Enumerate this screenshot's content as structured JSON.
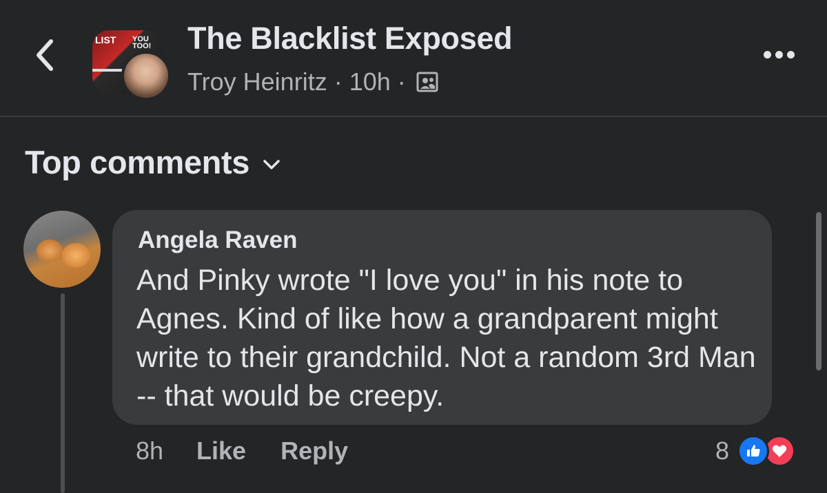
{
  "header": {
    "back_icon": "chevron-left-icon",
    "group_name": "The Blacklist Exposed",
    "group_avatar_text_1": "LIST",
    "group_avatar_text_2": "YOU TOO!",
    "author": "Troy Heinritz",
    "separator": "·",
    "time": "10h",
    "privacy_icon": "group-members-icon",
    "more_icon": "more-horizontal-icon"
  },
  "sort": {
    "label": "Top comments",
    "icon": "chevron-down-icon"
  },
  "comment": {
    "author": "Angela Raven",
    "text": "And Pinky wrote \"I love you\" in his note to Agnes. Kind of like how a grandparent might write to their grandchild. Not a random 3rd Man -- that would be creepy.",
    "time": "8h",
    "like_label": "Like",
    "reply_label": "Reply",
    "reaction_count": "8",
    "reaction_icons": [
      "like-reaction-icon",
      "love-reaction-icon"
    ]
  },
  "colors": {
    "background": "#242526",
    "bubble": "#3a3b3c",
    "primary_text": "#e4e6eb",
    "secondary_text": "#b0b3b8",
    "like_blue": "#1877f2",
    "love_red": "#f33e58"
  }
}
